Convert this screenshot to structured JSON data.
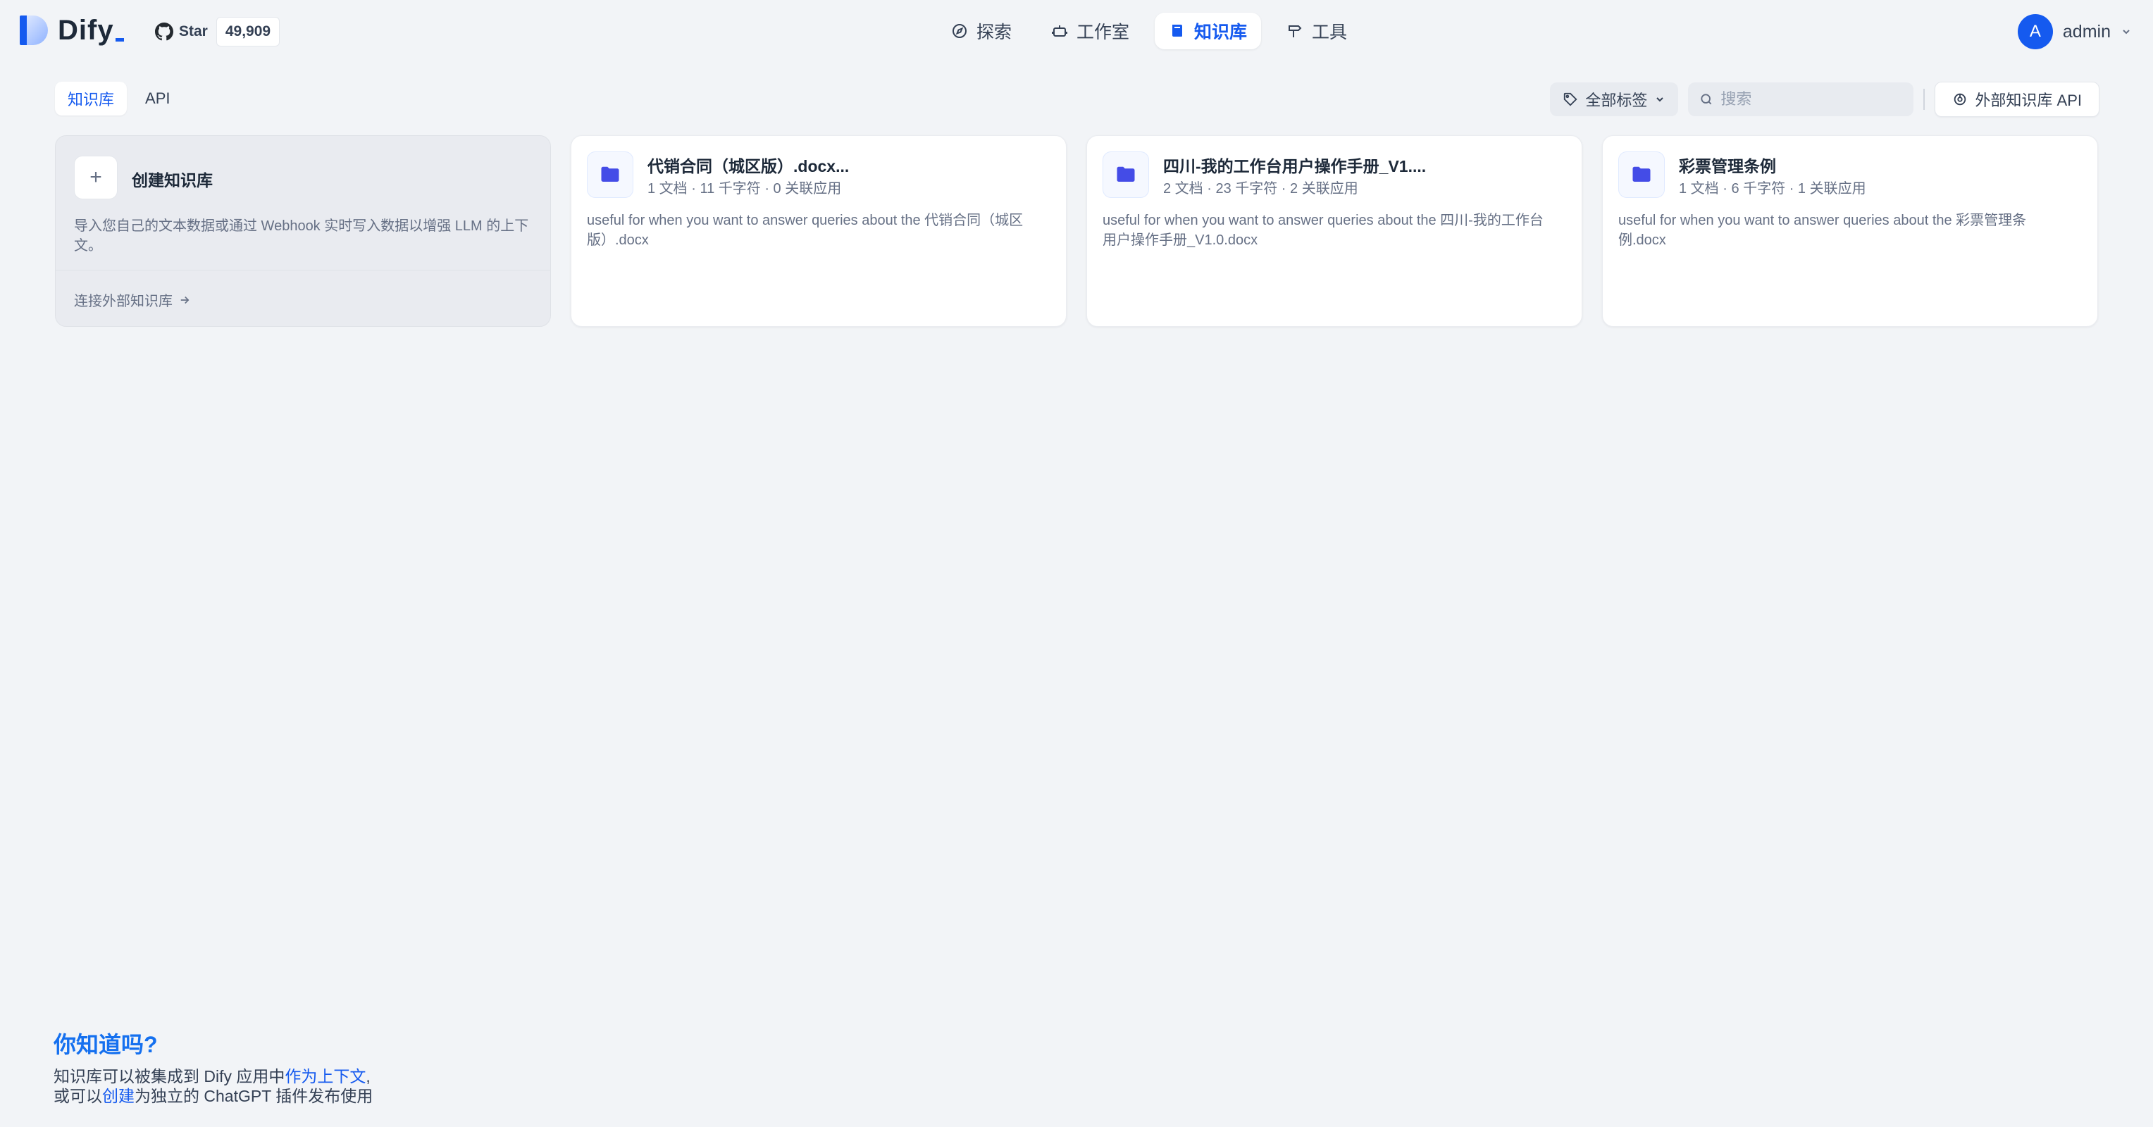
{
  "app": {
    "logo_text": "Dify",
    "github_star_label": "Star",
    "github_star_count": "49,909"
  },
  "nav": {
    "items": [
      {
        "label": "探索",
        "icon": "compass-icon",
        "active": false
      },
      {
        "label": "工作室",
        "icon": "robot-icon",
        "active": false
      },
      {
        "label": "知识库",
        "icon": "book-icon",
        "active": true
      },
      {
        "label": "工具",
        "icon": "hammer-icon",
        "active": false
      }
    ]
  },
  "user": {
    "avatar_initial": "A",
    "name": "admin"
  },
  "tabs": [
    {
      "label": "知识库",
      "active": true
    },
    {
      "label": "API",
      "active": false
    }
  ],
  "toolbar": {
    "tag_filter_label": "全部标签",
    "search_placeholder": "搜索",
    "external_api_label": "外部知识库 API"
  },
  "create_card": {
    "title": "创建知识库",
    "description": "导入您自己的文本数据或通过 Webhook 实时写入数据以增强 LLM 的上下文。",
    "connect_label": "连接外部知识库"
  },
  "datasets": [
    {
      "name": "代销合同（城区版）.docx...",
      "meta": "1 文档 · 11 千字符 · 0 关联应用",
      "description": "useful for when you want to answer queries about the 代销合同（城区版）.docx"
    },
    {
      "name": "四川-我的工作台用户操作手册_V1....",
      "meta": "2 文档 · 23 千字符 · 2 关联应用",
      "description": "useful for when you want to answer queries about the 四川-我的工作台用户操作手册_V1.0.docx"
    },
    {
      "name": "彩票管理条例",
      "meta": "1 文档 · 6 千字符 · 1 关联应用",
      "description": "useful for when you want to answer queries about the 彩票管理条例.docx"
    }
  ],
  "tip": {
    "title": "你知道吗?",
    "line1_prefix": "知识库可以被集成到 Dify 应用中",
    "line1_link": "作为上下文",
    "line1_suffix": ",",
    "line2_prefix": "或可以",
    "line2_link": "创建",
    "line2_suffix": "为独立的 ChatGPT 插件发布使用"
  },
  "colors": {
    "accent": "#155aef",
    "background": "#f2f4f7",
    "card": "#ffffff",
    "folder_icon": "#444ce7"
  }
}
